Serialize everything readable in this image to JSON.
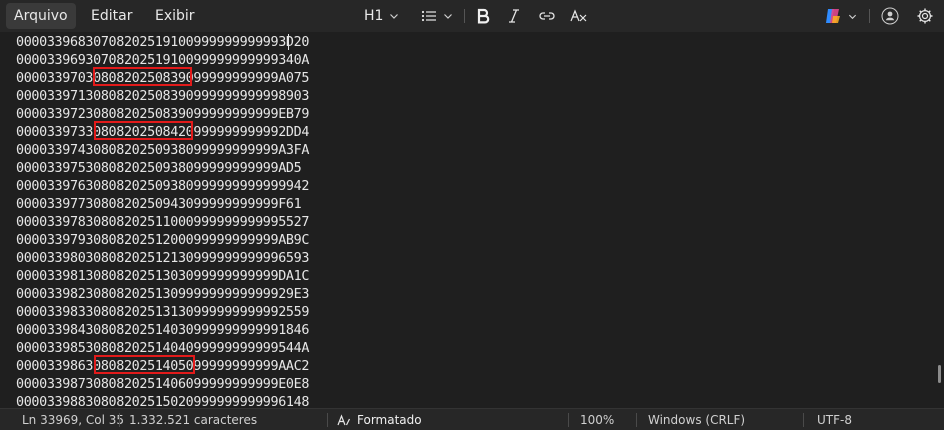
{
  "menu": {
    "file": "Arquivo",
    "edit": "Editar",
    "view": "Exibir"
  },
  "toolbar": {
    "heading": "H1"
  },
  "editor": {
    "lines": [
      "00003396830708202519100999999999993D20",
      "0000339693070820251910099999999999340A",
      "0000339703080820250839099999999999A075",
      "00003397130808202508390999999999998903",
      "0000339723080820250839099999999999EB79",
      "00003397330808202508420999999999992DD4",
      "0000339743080820250938099999999999A3FA",
      "0000339753080820250938099999999999AD5",
      "00003397630808202509380999999999999942",
      "0000339773080820250943099999999999F61",
      "00003397830808202511000999999999995527",
      "0000339793080820251200099999999999AB9C",
      "00003398030808202512130999999999996593",
      "0000339813080820251303099999999999DA1C",
      "000033982308082025130999999999999929E3",
      "00003398330808202513130999999999992559",
      "00003398430808202514030999999999991846",
      "0000339853080820251404099999999999544A",
      "0000339863080820251405099999999999AAC2",
      "0000339873080820251406099999999999E0E8",
      "00003398830808202515020999999999996148"
    ]
  },
  "status": {
    "position": "Ln 33969, Col 35",
    "chars": "1.332.521 caracteres",
    "format": "Formatado",
    "zoom": "100%",
    "line_ending": "Windows (CRLF)",
    "encoding": "UTF-8"
  }
}
